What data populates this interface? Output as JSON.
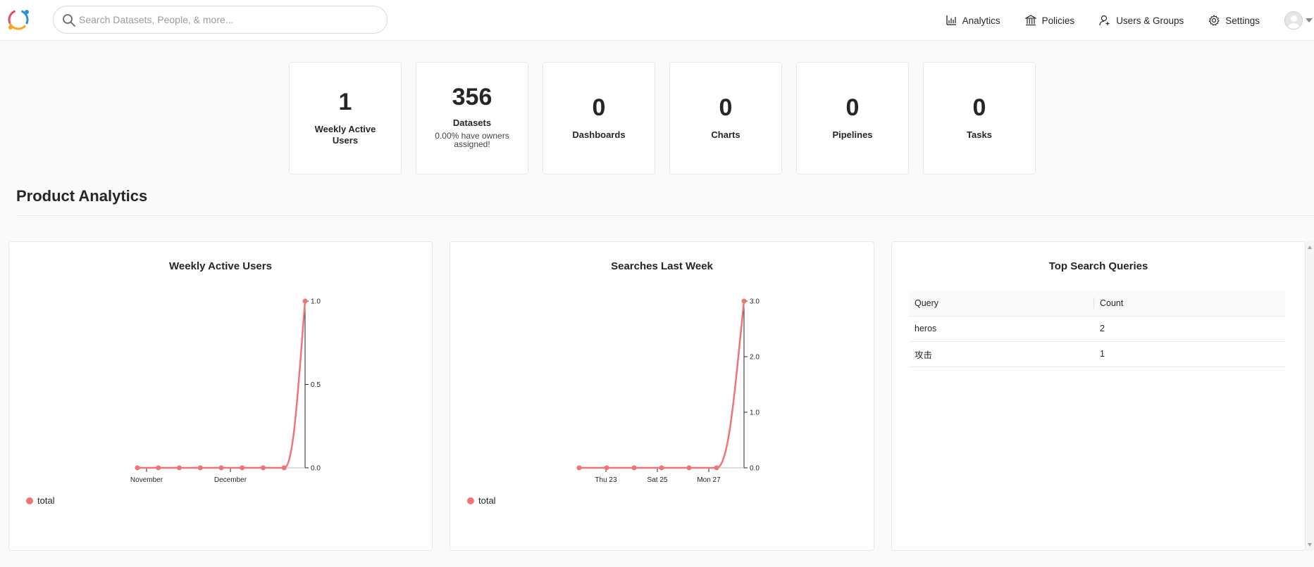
{
  "search": {
    "placeholder": "Search Datasets, People, & more..."
  },
  "nav": {
    "analytics": "Analytics",
    "policies": "Policies",
    "users_groups": "Users & Groups",
    "settings": "Settings"
  },
  "highlights": [
    {
      "value": "1",
      "label": "Weekly Active Users",
      "sub": ""
    },
    {
      "value": "356",
      "label": "Datasets",
      "sub": "0.00% have owners assigned!"
    },
    {
      "value": "0",
      "label": "Dashboards",
      "sub": ""
    },
    {
      "value": "0",
      "label": "Charts",
      "sub": ""
    },
    {
      "value": "0",
      "label": "Pipelines",
      "sub": ""
    },
    {
      "value": "0",
      "label": "Tasks",
      "sub": ""
    }
  ],
  "section": {
    "title": "Product Analytics"
  },
  "colors": {
    "series": "#f07377"
  },
  "chart_data": [
    {
      "type": "line",
      "title": "Weekly Active Users",
      "x_tick_labels": [
        "November",
        "December"
      ],
      "series": [
        {
          "name": "total",
          "values": [
            0,
            0,
            0,
            0,
            0,
            0,
            0,
            0,
            1
          ]
        }
      ],
      "ylim": [
        0,
        1
      ],
      "y_ticks": [
        "0.0",
        "0.5",
        "1.0"
      ],
      "legend": "bottom-left",
      "grid": false
    },
    {
      "type": "line",
      "title": "Searches Last Week",
      "x_tick_labels": [
        "Thu 23",
        "Sat 25",
        "Mon 27"
      ],
      "series": [
        {
          "name": "total",
          "values": [
            0,
            0,
            0,
            0,
            0,
            0,
            3
          ]
        }
      ],
      "ylim": [
        0,
        3
      ],
      "y_ticks": [
        "0.0",
        "1.0",
        "2.0",
        "3.0"
      ],
      "legend": "bottom-left",
      "grid": false
    },
    {
      "type": "table",
      "title": "Top Search Queries",
      "columns": [
        "Query",
        "Count"
      ],
      "rows": [
        [
          "heros",
          "2"
        ],
        [
          "攻击",
          "1"
        ]
      ]
    }
  ]
}
